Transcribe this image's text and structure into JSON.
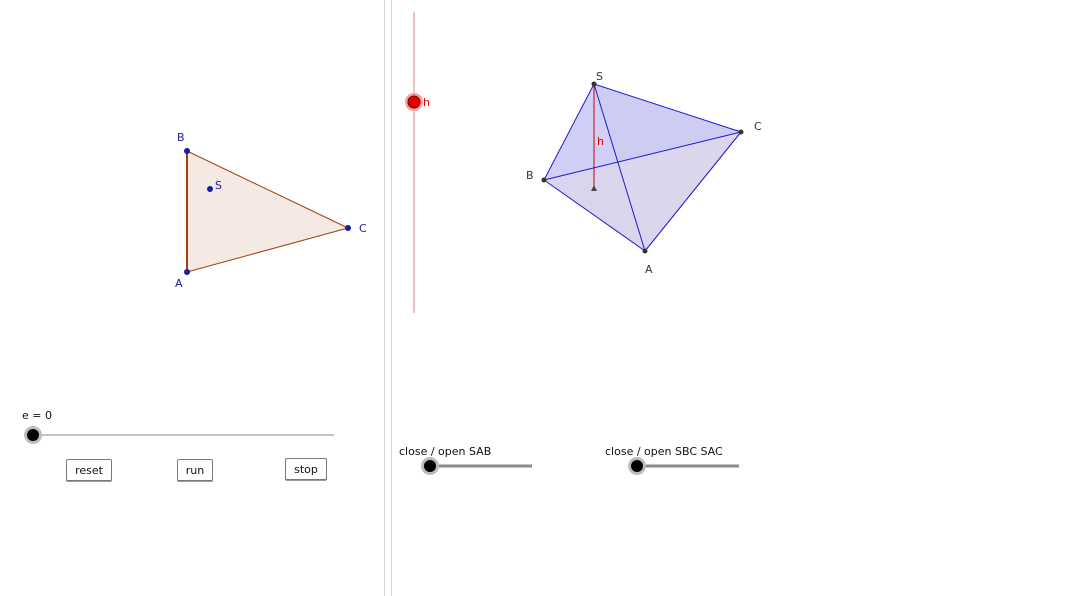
{
  "left_view": {
    "triangle": {
      "fill": "#f5e9e3",
      "stroke": "#a0410f",
      "point_color": "#1a1aa6",
      "labels": {
        "A": "A",
        "B": "B",
        "C": "C",
        "S": "S"
      }
    },
    "slider_e": {
      "label": "e = 0",
      "value": 0
    },
    "buttons": {
      "reset": "reset",
      "run": "run",
      "stop": "stop"
    }
  },
  "right_view": {
    "h_slider": {
      "label": "h",
      "color": "#e00000"
    },
    "pyramid": {
      "fill": "#cfcff6",
      "edge_color": "#1a1ad0",
      "height_color": "#d00000",
      "labels": {
        "S": "S",
        "A": "A",
        "B": "B",
        "C": "C",
        "h": "h"
      }
    },
    "slider_sab": {
      "label": "close / open SAB",
      "value": 0
    },
    "slider_sbc_sac": {
      "label": "close / open SBC SAC",
      "value": 0
    }
  }
}
